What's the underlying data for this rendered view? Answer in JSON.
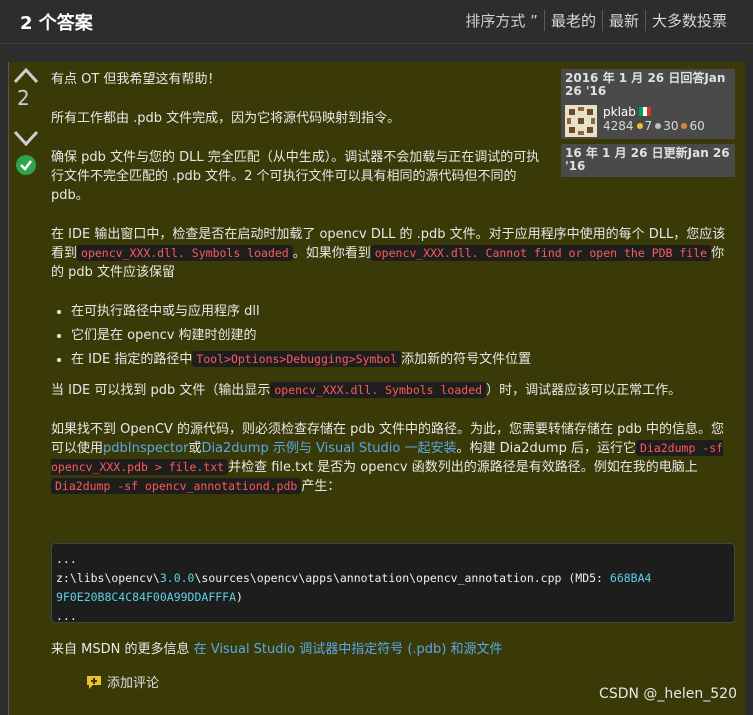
{
  "header": {
    "title": "2 个答案",
    "sort_label": "排序方式 ”",
    "sort_options": [
      "最老的",
      "最新",
      "大多数投票"
    ]
  },
  "vote": {
    "count": "2"
  },
  "answer": {
    "p1": "有点 OT 但我希望这有帮助！",
    "p2": "所有工作都由 .pdb 文件完成，因为它将源代码映射到指令。",
    "p3": "确保 pdb 文件与您的 DLL 完全匹配（从中生成）。调试器不会加载与正在调试的可执行文件不完全匹配的 .pdb 文件。2 个可执行文件可以具有相同的源代码但不同的 pdb。",
    "p4_a": "在 IDE 输出窗口中，检查是否在启动时加载了 opencv DLL 的 .pdb 文件。对于应用程序中使用的每个 DLL，您应该看到",
    "p4_code1": "opencv_XXX.dll. Symbols loaded",
    "p4_b": "。如果你看到",
    "p4_code2": "opencv_XXX.dll. Cannot find or open the PDB file",
    "p4_c": "你的 pdb 文件应该保留",
    "bullets": [
      "在可执行路径中或与应用程序 dll",
      "它们是在 opencv 构建时创建的"
    ],
    "bullet3_a": "在 IDE 指定的路径中",
    "bullet3_code": "Tool>Options>Debugging>Symbol",
    "bullet3_b": "添加新的符号文件位置",
    "p5_a": "当 IDE 可以找到 pdb 文件（输出显示",
    "p5_code": "opencv_XXX.dll. Symbols loaded",
    "p5_b": "）时，调试器应该可以正常工作。",
    "p6_a": "如果找不到 OpenCV 的源代码，则必须检查存储在 pdb 文件中的路径。为此，您需要转储存储在 pdb 中的信息。您可以使用",
    "p6_link1": "pdbInspector",
    "p6_or": "或",
    "p6_link2": "Dia2dump 示例与 Visual Studio 一起安装",
    "p6_b": "。构建 Dia2dump 后，运行它",
    "p6_code1": "Dia2dump -sf opencv_XXX.pdb > file.txt",
    "p6_c": "并检查 file.txt 是否为 opencv 函数列出的源路径是有效路径。例如在我的电脑上",
    "p6_code2": "Dia2dump -sf opencv_annotationd.pdb",
    "p6_d": "产生："
  },
  "code_block": {
    "line1": "...",
    "line2_a": "z:\\libs\\opencv\\",
    "line2_hl": "3.0.0",
    "line2_b": "\\sources\\opencv\\apps\\annotation\\opencv_annotation.cpp (MD5: ",
    "line2_hl2": "668BA4",
    "line3_hl": "9F0E20B8C4C84F00A99DDAFFFA",
    "line3_b": ")",
    "line4": "..."
  },
  "answered_card": {
    "date": "2016 年 1 月 26 日回答Jan 26 '16",
    "username": "pklab",
    "reputation": "4284",
    "gold": "7",
    "silver": "30",
    "bronze": "60"
  },
  "updated_card": {
    "date": "16 年 1 月 26 日更新Jan 26 '16"
  },
  "more_info": {
    "prefix": "来自 MSDN 的更多信息 ",
    "link": "在 Visual Studio 调试器中指定符号 (.pdb) 和源文件"
  },
  "add_comment": "添加评论",
  "watermark": "CSDN @_helen_520",
  "colors": {
    "panel_bg": "#3a3a08",
    "code_red": "#ff5a5a",
    "link": "#5aa7e6",
    "accepted": "#2fa44f"
  }
}
